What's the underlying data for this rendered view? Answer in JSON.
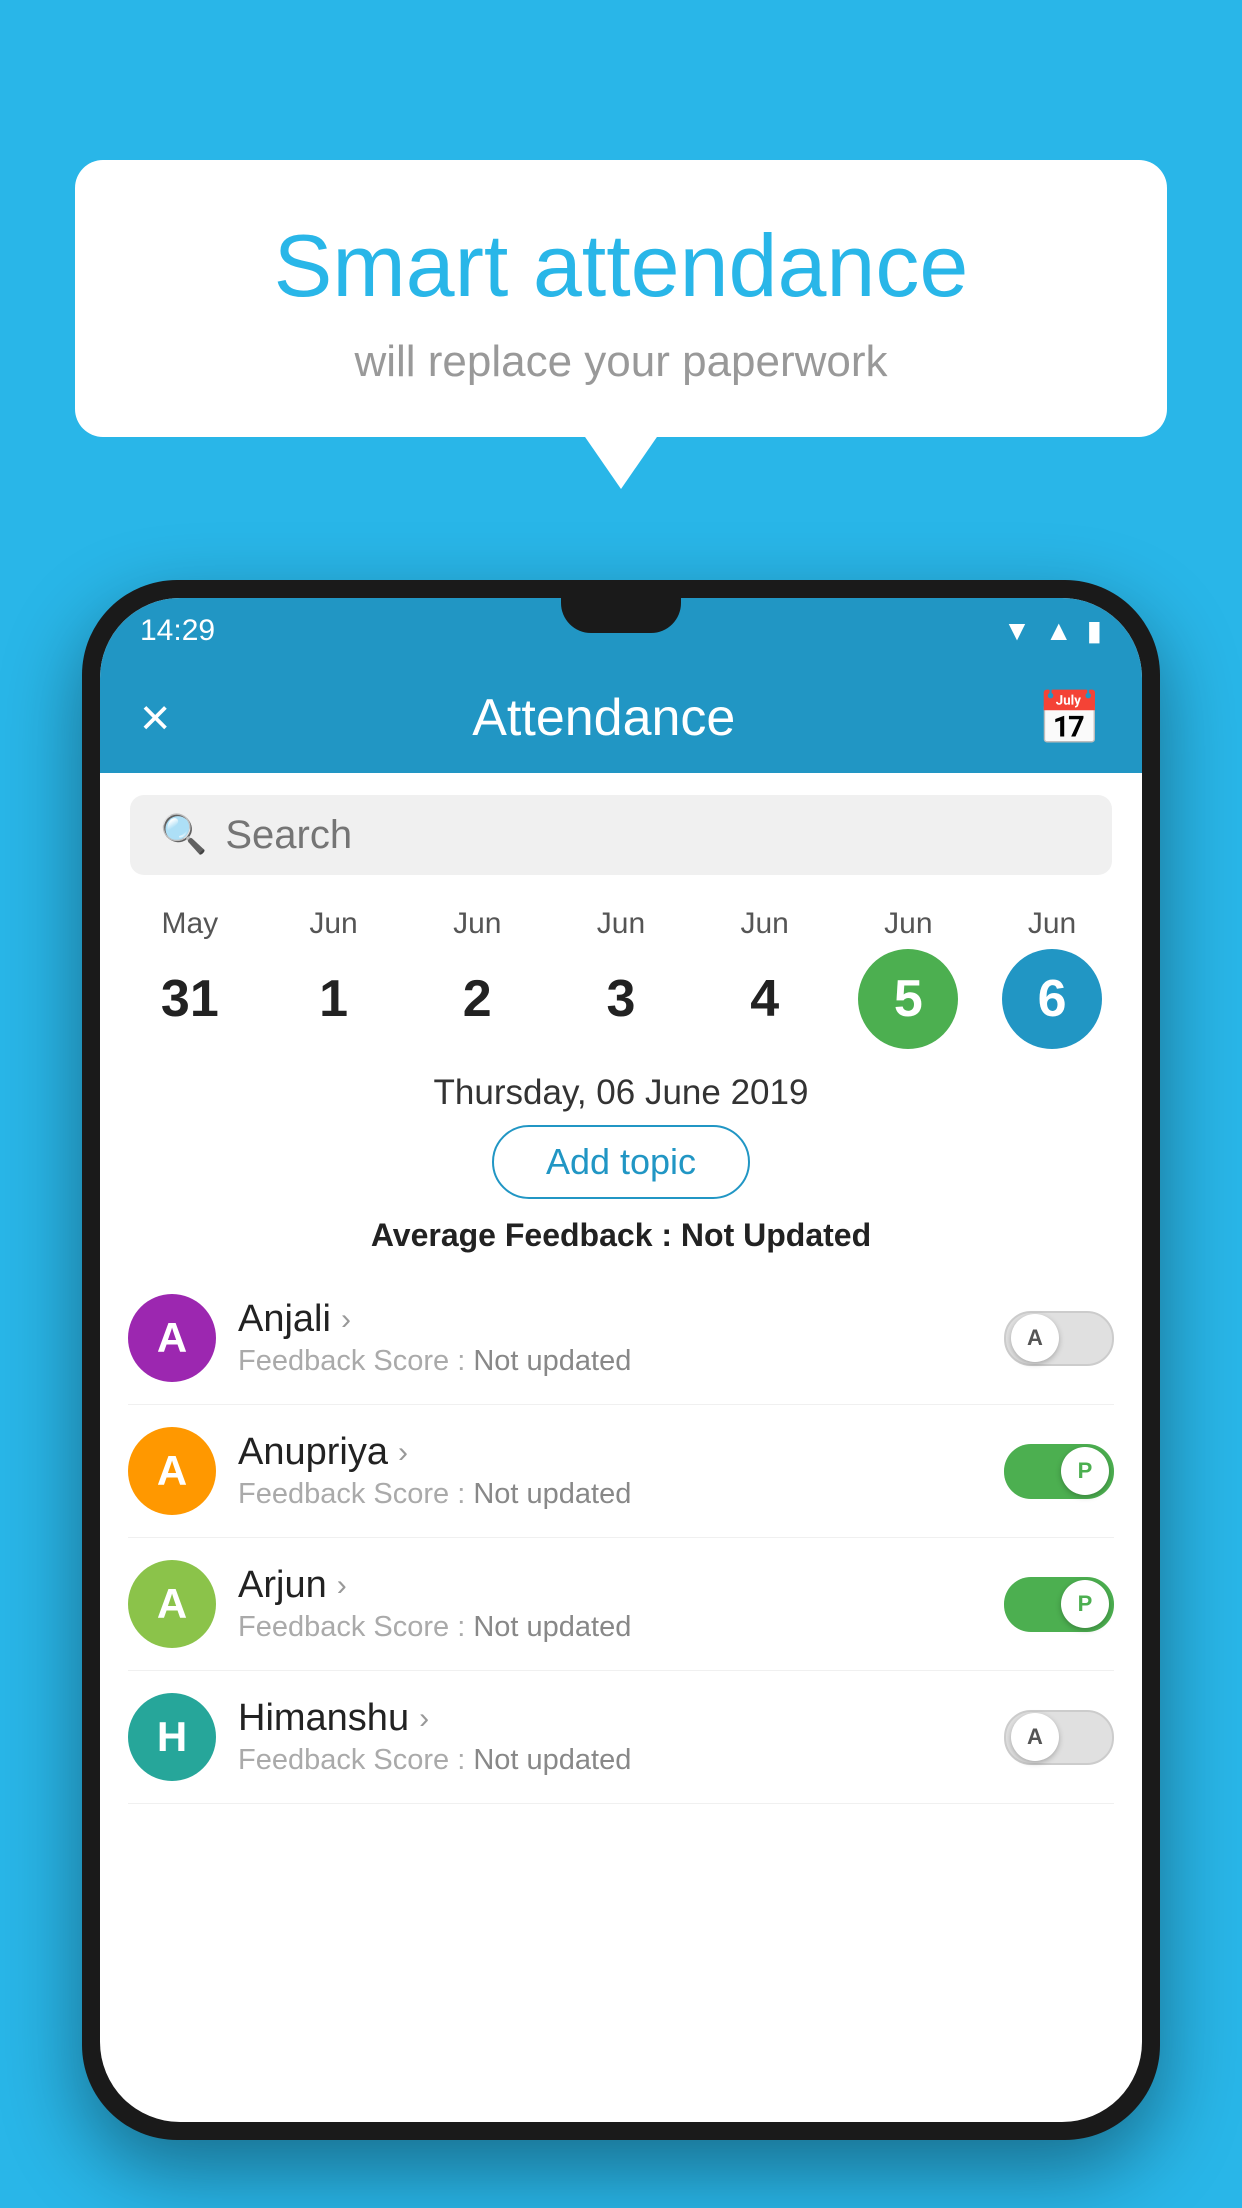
{
  "background_color": "#29b6e8",
  "speech_bubble": {
    "title": "Smart attendance",
    "subtitle": "will replace your paperwork"
  },
  "status_bar": {
    "time": "14:29",
    "icons": [
      "wifi",
      "signal",
      "battery"
    ]
  },
  "app_bar": {
    "title": "Attendance",
    "close_label": "×",
    "calendar_icon": "📅"
  },
  "search": {
    "placeholder": "Search"
  },
  "calendar": {
    "dates": [
      {
        "month": "May",
        "day": "31",
        "state": "normal"
      },
      {
        "month": "Jun",
        "day": "1",
        "state": "normal"
      },
      {
        "month": "Jun",
        "day": "2",
        "state": "normal"
      },
      {
        "month": "Jun",
        "day": "3",
        "state": "normal"
      },
      {
        "month": "Jun",
        "day": "4",
        "state": "normal"
      },
      {
        "month": "Jun",
        "day": "5",
        "state": "today"
      },
      {
        "month": "Jun",
        "day": "6",
        "state": "selected"
      }
    ]
  },
  "selected_date_label": "Thursday, 06 June 2019",
  "add_topic_label": "Add topic",
  "average_feedback_label": "Average Feedback :",
  "average_feedback_value": "Not Updated",
  "students": [
    {
      "name": "Anjali",
      "feedback_label": "Feedback Score :",
      "feedback_value": "Not updated",
      "avatar_letter": "A",
      "avatar_color": "purple",
      "toggle_state": "off",
      "toggle_letter": "A"
    },
    {
      "name": "Anupriya",
      "feedback_label": "Feedback Score :",
      "feedback_value": "Not updated",
      "avatar_letter": "A",
      "avatar_color": "orange",
      "toggle_state": "on",
      "toggle_letter": "P"
    },
    {
      "name": "Arjun",
      "feedback_label": "Feedback Score :",
      "feedback_value": "Not updated",
      "avatar_letter": "A",
      "avatar_color": "green",
      "toggle_state": "on",
      "toggle_letter": "P"
    },
    {
      "name": "Himanshu",
      "feedback_label": "Feedback Score :",
      "feedback_value": "Not updated",
      "avatar_letter": "H",
      "avatar_color": "teal",
      "toggle_state": "off",
      "toggle_letter": "A"
    }
  ]
}
